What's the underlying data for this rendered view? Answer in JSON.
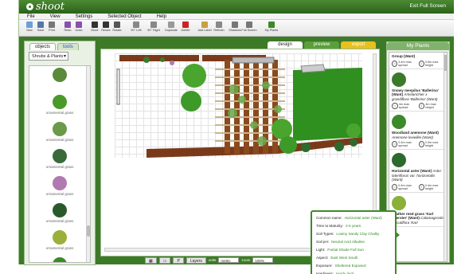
{
  "app": {
    "logo": "shoot",
    "exit_label": "Exit Full Screen"
  },
  "menu": [
    "File",
    "View",
    "Settings",
    "Selected Object",
    "Help"
  ],
  "toolbar": [
    {
      "label": "New",
      "icon": "new-icon",
      "color": "#6aa0d8"
    },
    {
      "label": "Save",
      "icon": "save-icon",
      "color": "#5577aa"
    },
    {
      "label": "Print",
      "icon": "print-icon",
      "color": "#777777"
    },
    {
      "label": "Redo",
      "icon": "redo-icon",
      "color": "#8a4fb0"
    },
    {
      "label": "Undo",
      "icon": "undo-icon",
      "color": "#8a4fb0"
    },
    {
      "label": "Move",
      "icon": "move-icon",
      "color": "#333333"
    },
    {
      "label": "Resize",
      "icon": "resize-icon",
      "color": "#333333"
    },
    {
      "label": "Rotate",
      "icon": "rotate-icon",
      "color": "#555555"
    },
    {
      "label": "90° Left",
      "icon": "rotate-left-icon",
      "color": "#888888"
    },
    {
      "label": "90° Right",
      "icon": "rotate-right-icon",
      "color": "#888888"
    },
    {
      "label": "Duplicate",
      "icon": "duplicate-icon",
      "color": "#999999"
    },
    {
      "label": "Delete",
      "icon": "delete-icon",
      "color": "#cc2222"
    },
    {
      "label": "Add Label",
      "icon": "label-icon",
      "color": "#c8a040"
    },
    {
      "label": "Refresh",
      "icon": "refresh-icon",
      "color": "#888888"
    },
    {
      "label": "Shadows",
      "icon": "shadows-icon",
      "color": "#777777"
    },
    {
      "label": "Full Screen",
      "icon": "fullscreen-icon",
      "color": "#777777"
    },
    {
      "label": "My Plants",
      "icon": "my-plants-icon",
      "color": "#3c8a2a"
    }
  ],
  "left_panel": {
    "tabs": [
      "objects",
      "tools"
    ],
    "category": "Shrubs & Plants",
    "items": [
      {
        "name": "",
        "color": "#5a8a3a"
      },
      {
        "name": "ornamental grass",
        "color": "#4a9a2a"
      },
      {
        "name": "ornamental grass",
        "color": "#6a9a4a"
      },
      {
        "name": "ornamental grass",
        "color": "#3a6a3a"
      },
      {
        "name": "ornamental grass",
        "color": "#b07ab0"
      },
      {
        "name": "ornamental grass",
        "color": "#2a5a2a"
      },
      {
        "name": "ornamental grass",
        "color": "#9ab03a"
      },
      {
        "name": "shrub",
        "color": "#3a8a2a"
      }
    ]
  },
  "center": {
    "tabs": [
      {
        "label": "design",
        "bg": "#ffffff",
        "color": "#222222"
      },
      {
        "label": "preview",
        "bg": "#5aa03a",
        "color": "#ffffff"
      },
      {
        "label": "export",
        "bg": "#e8c020",
        "color": "#ffffff"
      }
    ],
    "bottom": {
      "layers": "Layers",
      "units_label": "units",
      "units": "metric",
      "zoom_label": "zoom",
      "zoom": "100%"
    }
  },
  "tooltip": [
    {
      "k": "Common name:",
      "v": "Horizontal aster (Want)"
    },
    {
      "k": "Time to Maturity:",
      "v": "2-5 years"
    },
    {
      "k": "Soil Types:",
      "v": "Loamy Sandy Clay Chalky"
    },
    {
      "k": "Soil pH:",
      "v": "Neutral Acid Alkaline"
    },
    {
      "k": "Light:",
      "v": "Partial Shade Full Sun"
    },
    {
      "k": "Aspect:",
      "v": "East West South"
    },
    {
      "k": "Exposure:",
      "v": "Sheltered Exposed"
    },
    {
      "k": "Hardiness:",
      "v": "Hardy (H4)"
    }
  ],
  "right_panel": {
    "title": "My Plants",
    "entries": [
      {
        "name": "Group (Want)",
        "latin": "",
        "spread": "3.4m max spread",
        "height": "3.5m max height",
        "icon_color": ""
      },
      {
        "name": "Snowy mespilus 'Ballerina' (Want)",
        "latin": "Amelanchier x grandiflora 'Ballerina' (Want)",
        "spread": "4m max spread",
        "height": "4m max height",
        "icon_color": "#3a7a2a"
      },
      {
        "name": "Woodland anemone (Want)",
        "latin": "Anemone levieillei (Want)",
        "spread": "0.4m max spread",
        "height": "0.3m max height",
        "icon_color": "#3a8a2a"
      },
      {
        "name": "Horizontal aster (Want)",
        "latin": "Aster lateriflorus var. horizontalis (Want)",
        "spread": "0.4m max spread",
        "height": "0.4m max height",
        "icon_color": "#2e6a2e"
      },
      {
        "name": "Feather reed grass 'Karl Foerster' (Want)",
        "latin": "Calamagrostis x acutiflora 'Karl",
        "spread": "",
        "height": "",
        "icon_color": "#8ab03a"
      }
    ]
  },
  "colors": {
    "brand": "#3d7a27",
    "deck": "#7a3a1a",
    "lawn": "#2f8f1f",
    "accent": "#3d8a2a"
  }
}
